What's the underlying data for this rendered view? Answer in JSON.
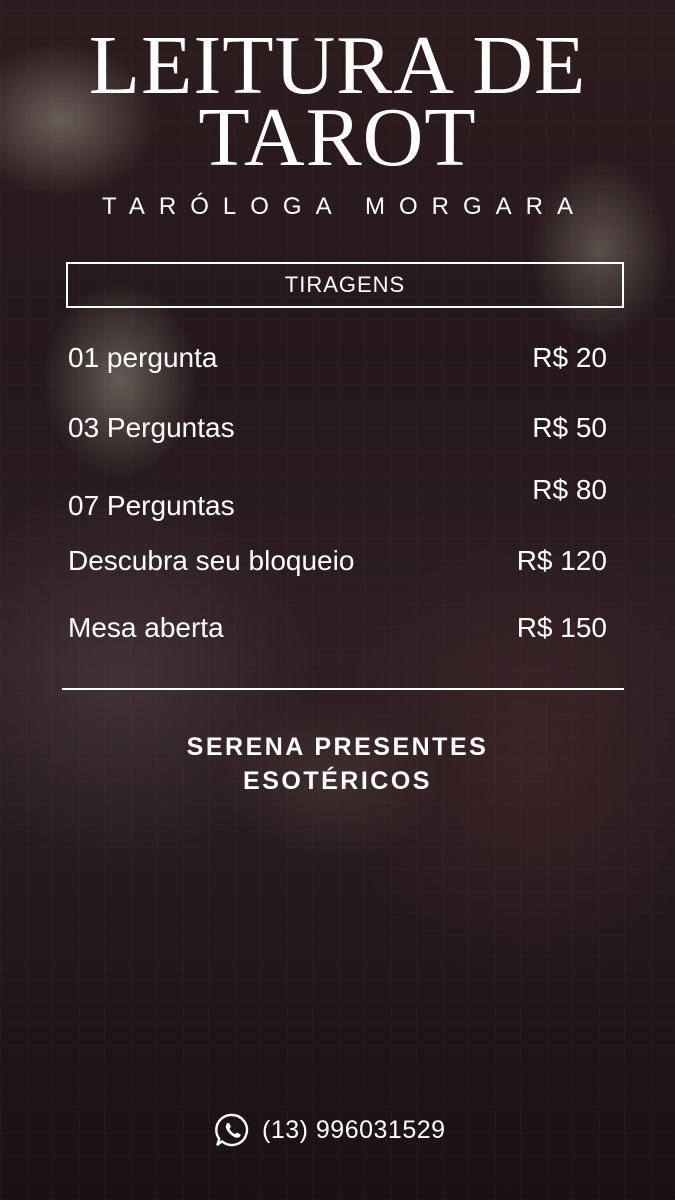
{
  "header": {
    "title_line1": "LEITURA DE",
    "title_line2": "TAROT",
    "subtitle": "TARÓLOGA MORGARA"
  },
  "section": {
    "label": "TIRAGENS"
  },
  "items": [
    {
      "name": "01 pergunta",
      "price": "R$ 20"
    },
    {
      "name": "03 Perguntas",
      "price": "R$ 50"
    },
    {
      "name": "07 Perguntas",
      "price": "R$ 80"
    },
    {
      "name": "Descubra seu bloqueio",
      "price": "R$ 120"
    },
    {
      "name": "Mesa aberta",
      "price": "R$ 150"
    }
  ],
  "shop": {
    "line1": "SERENA PRESENTES",
    "line2": "ESOTÉRICOS"
  },
  "contact": {
    "icon": "whatsapp-icon",
    "phone": "(13) 996031529"
  },
  "colors": {
    "text": "#ffffff",
    "background": "#2f2023"
  }
}
